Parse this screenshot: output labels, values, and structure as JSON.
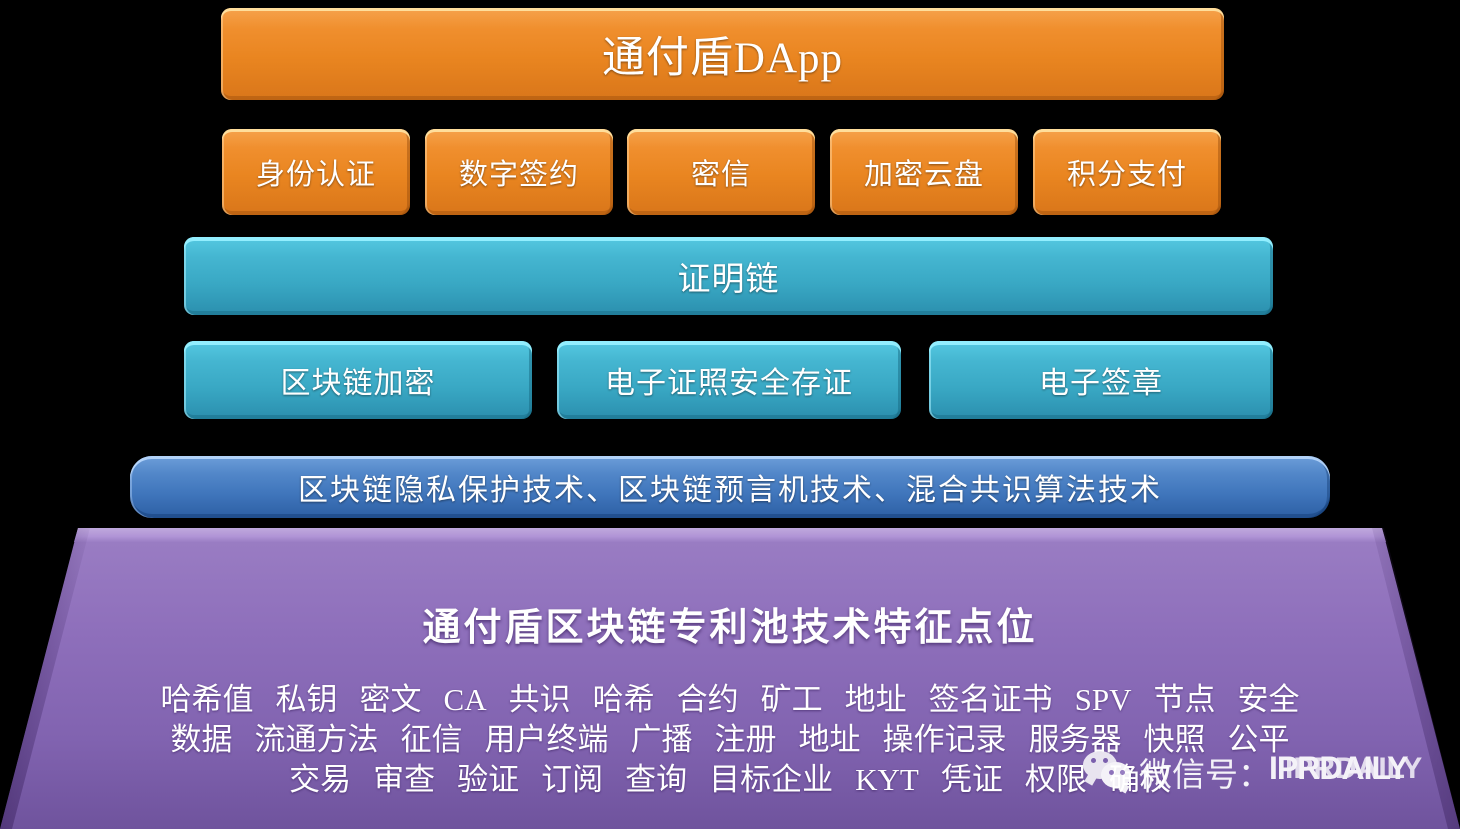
{
  "diagram": {
    "title_banner": "通付盾DApp",
    "app_modules": [
      "身份认证",
      "数字签约",
      "密信",
      "加密云盘",
      "积分支付"
    ],
    "chain_layer": "证明链",
    "tech_modules": [
      "区块链加密",
      "电子证照安全存证",
      "电子签章"
    ],
    "algorithm_layer": "区块链隐私保护技术、区块链预言机技术、混合共识算法技术",
    "base": {
      "title": "通付盾区块链专利池技术特征点位",
      "keyword_rows": [
        [
          "哈希值",
          "私钥",
          "密文",
          "CA",
          "共识",
          "哈希",
          "合约",
          "矿工",
          "地址",
          "签名证书",
          "SPV",
          "节点",
          "安全"
        ],
        [
          "数据",
          "流通方法",
          "征信",
          "用户终端",
          "广播",
          "注册",
          "地址",
          "操作记录",
          "服务器",
          "快照",
          "公平"
        ],
        [
          "交易",
          "审查",
          "验证",
          "订阅",
          "查询",
          "目标企业",
          "KYT",
          "凭证",
          "权限",
          "确权"
        ]
      ]
    }
  },
  "watermark": {
    "icon": "wechat-icon",
    "cn_text": "微信号：",
    "en_text": "IPRDAILY",
    "en_text_overlay": "IPRDAILY"
  },
  "colors": {
    "background": "#000000",
    "orange_top": "#f6a34d",
    "orange_bottom": "#d9761a",
    "teal_top": "#55c9e2",
    "teal_bottom": "#2b8fae",
    "blue_top": "#6d9ed9",
    "blue_bottom": "#2d5fa4",
    "purple_top": "#9b7ec4",
    "purple_bottom": "#6f539d",
    "text": "#ffffff"
  }
}
